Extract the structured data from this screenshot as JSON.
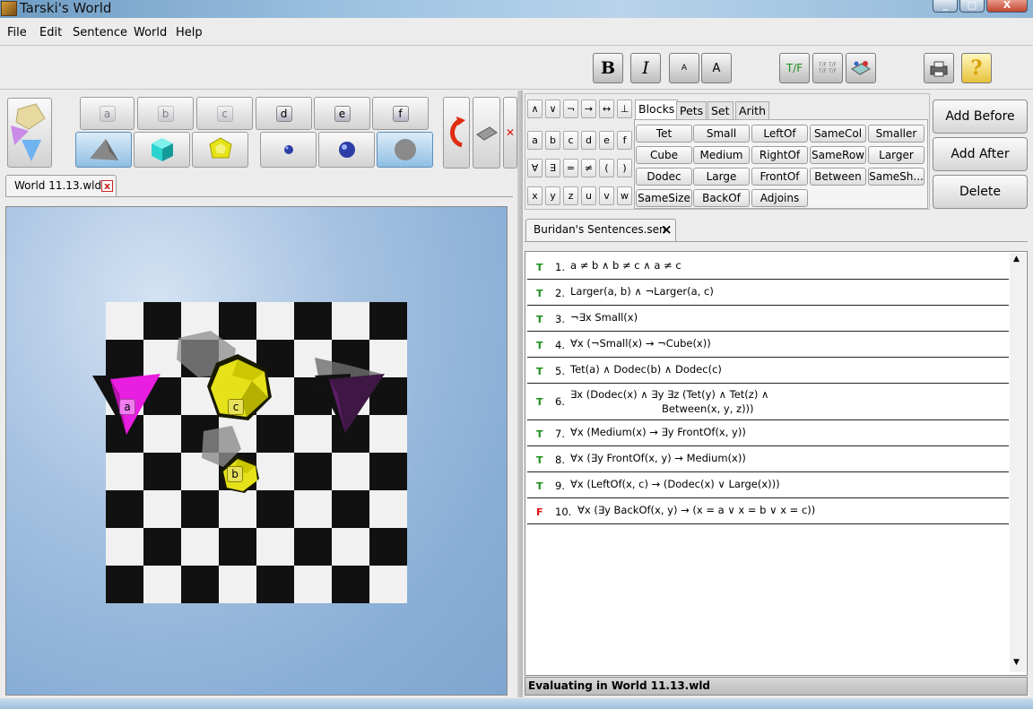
{
  "window": {
    "title": "Tarski's World",
    "minimize": "_",
    "maximize": "□",
    "close": "X"
  },
  "menu": [
    "File",
    "Edit",
    "Sentence",
    "World",
    "Help"
  ],
  "toolbar": {
    "bold": "B",
    "italic": "I",
    "small_a": "A",
    "large_a": "A",
    "tf": "T/F",
    "tf_all": "T/F T/F T/F T/F"
  },
  "palette": {
    "labels": [
      "a",
      "b",
      "c",
      "d",
      "e",
      "f"
    ]
  },
  "world_tab": {
    "label": "World 11.13.wld",
    "close": "x"
  },
  "world": {
    "objects": [
      "a",
      "c",
      "b"
    ]
  },
  "keyboard": {
    "rows": [
      [
        "∧",
        "∨",
        "¬",
        "→",
        "↔",
        "⊥"
      ],
      [
        "a",
        "b",
        "c",
        "d",
        "e",
        "f"
      ],
      [
        "∀",
        "∃",
        "=",
        "≠",
        "(",
        ")"
      ],
      [
        "x",
        "y",
        "z",
        "u",
        "v",
        "w"
      ]
    ],
    "tabs": [
      "Blocks",
      "Pets",
      "Set",
      "Arith"
    ],
    "predicates": [
      [
        "Tet",
        "Small",
        "LeftOf",
        "SameCol",
        "Smaller"
      ],
      [
        "Cube",
        "Medium",
        "RightOf",
        "SameRow",
        "Larger"
      ],
      [
        "Dodec",
        "Large",
        "FrontOf",
        "Between",
        "SameSh..."
      ],
      [
        "SameSize",
        "BackOf",
        "Adjoins"
      ]
    ]
  },
  "actions": [
    "Add Before",
    "Add After",
    "Delete"
  ],
  "sentence_tab": {
    "label": "Buridan's Sentences.sen",
    "close": "×"
  },
  "sentences": [
    {
      "tv": "T",
      "num": "1.",
      "text": "a ≠ b ∧ b ≠ c ∧ a ≠ c"
    },
    {
      "tv": "T",
      "num": "2.",
      "text": "Larger(a, b) ∧ ¬Larger(a, c)"
    },
    {
      "tv": "T",
      "num": "3.",
      "text": "¬∃x Small(x)"
    },
    {
      "tv": "T",
      "num": "4.",
      "text": "∀x (¬Small(x) → ¬Cube(x))"
    },
    {
      "tv": "T",
      "num": "5.",
      "text": "Tet(a) ∧ Dodec(b) ∧ Dodec(c)"
    },
    {
      "tv": "T",
      "num": "6.",
      "text": "∃x (Dodec(x) ∧ ∃y ∃z (Tet(y) ∧ Tet(z) ∧",
      "text2": "Between(x, y, z)))"
    },
    {
      "tv": "T",
      "num": "7.",
      "text": "∀x (Medium(x) → ∃y FrontOf(x, y))"
    },
    {
      "tv": "T",
      "num": "8.",
      "text": "∀x (∃y FrontOf(x, y) → Medium(x))"
    },
    {
      "tv": "T",
      "num": "9.",
      "text": "∀x (LeftOf(x, c) → (Dodec(x) ∨ Large(x)))"
    },
    {
      "tv": "F",
      "num": "10.",
      "text": "∀x (∃y BackOf(x, y) → (x = a ∨ x = b ∨ x = c))"
    }
  ],
  "status": "Evaluating in World 11.13.wld",
  "colors": {
    "tet": "#e81ee0",
    "dodec": "#e6e21a",
    "cube": "#2ad3cf",
    "true": "#1a8f1a",
    "false": "#d11111"
  }
}
